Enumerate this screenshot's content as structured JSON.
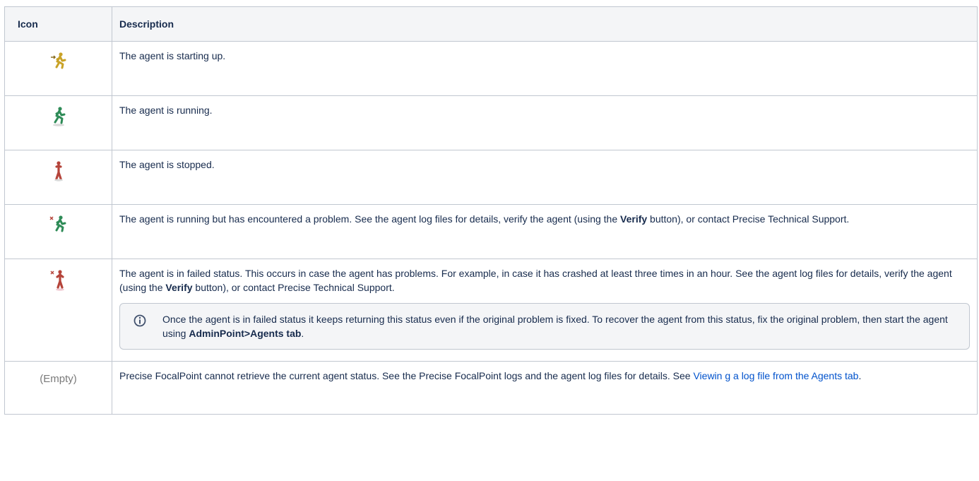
{
  "table": {
    "headers": {
      "icon": "Icon",
      "description": "Description"
    },
    "rows": [
      {
        "icon": "agent-starting-icon",
        "text": "The agent is starting up."
      },
      {
        "icon": "agent-running-icon",
        "text": "The agent is running."
      },
      {
        "icon": "agent-stopped-icon",
        "text": "The agent is stopped."
      },
      {
        "icon": "agent-problem-icon",
        "text_before": "The agent is running but has encountered a problem. See the agent log files for details, verify the agent (using the ",
        "bold": "Verify",
        "text_after": " button), or contact Precise Technical Support."
      },
      {
        "icon": "agent-failed-icon",
        "text_before": "The agent is in failed status. This occurs in case the agent has problems. For example, in case it has crashed at least three times in an hour. See the agent log files for details, verify the agent (using the ",
        "bold": "Verify",
        "text_after": " button), or contact Precise Technical Support.",
        "note": {
          "text_before": "Once the agent is in failed status it keeps returning this status even if the original problem is fixed. To recover the agent from this status, fix the original problem, then start the agent using ",
          "bold": "AdminPoint>Agents tab",
          "text_after": "."
        }
      },
      {
        "icon_label": "(Empty)",
        "text_before": "Precise FocalPoint cannot retrieve the current agent status. See the Precise FocalPoint logs and the agent log files for details. See ",
        "link": "Viewin g a log file from the Agents tab",
        "text_after": "."
      }
    ]
  },
  "colors": {
    "starting": "#c9a227",
    "running": "#2e8b57",
    "stopped": "#b5443a",
    "link": "#0052cc"
  }
}
